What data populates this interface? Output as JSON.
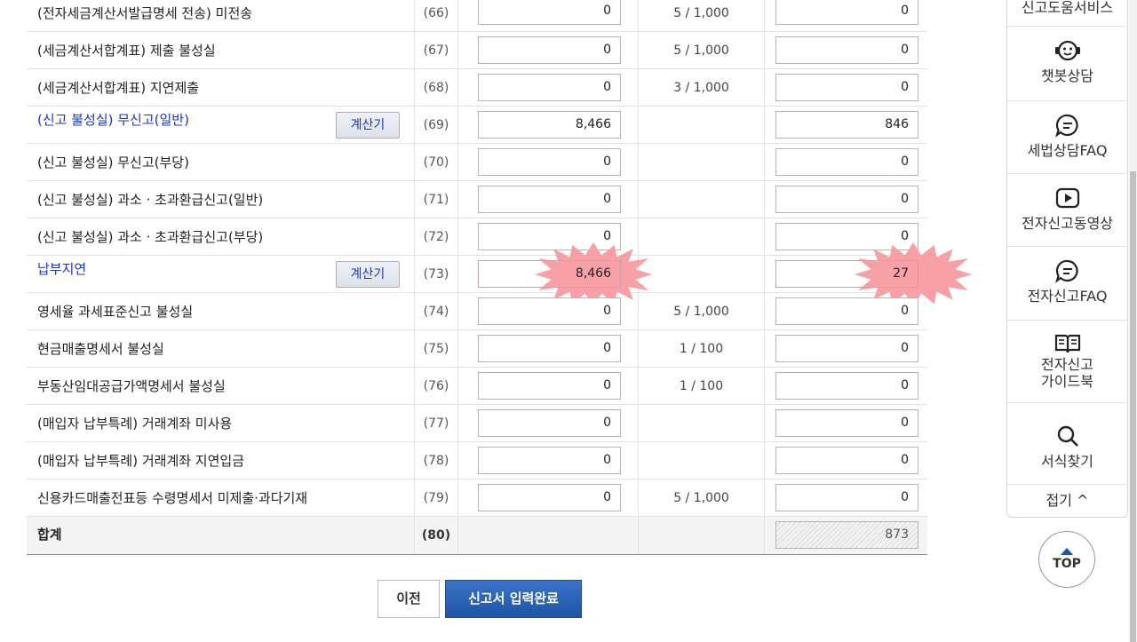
{
  "rows": [
    {
      "label": "(전자세금계산서발급명세 전송) 미전송",
      "code": "(66)",
      "amount": "0",
      "rate": "5 / 1,000",
      "penalty": "0"
    },
    {
      "label": "(세금계산서합계표) 제출 불성실",
      "code": "(67)",
      "amount": "0",
      "rate": "5 / 1,000",
      "penalty": "0"
    },
    {
      "label": "(세금계산서합계표) 지연제출",
      "code": "(68)",
      "amount": "0",
      "rate": "3 / 1,000",
      "penalty": "0"
    },
    {
      "label": "(신고 불성실) 무신고(일반)",
      "code": "(69)",
      "amount": "8,466",
      "rate": "",
      "penalty": "846",
      "calc": "계산기"
    },
    {
      "label": "(신고 불성실) 무신고(부당)",
      "code": "(70)",
      "amount": "0",
      "rate": "",
      "penalty": "0"
    },
    {
      "label": "(신고 불성실) 과소 · 초과환급신고(일반)",
      "code": "(71)",
      "amount": "0",
      "rate": "",
      "penalty": "0"
    },
    {
      "label": "(신고 불성실) 과소 · 초과환급신고(부당)",
      "code": "(72)",
      "amount": "0",
      "rate": "",
      "penalty": "0"
    },
    {
      "label": "납부지연",
      "code": "(73)",
      "amount": "8,466",
      "rate": "",
      "penalty": "27",
      "calc": "계산기"
    },
    {
      "label": "영세율 과세표준신고 불성실",
      "code": "(74)",
      "amount": "0",
      "rate": "5 / 1,000",
      "penalty": "0"
    },
    {
      "label": "현금매출명세서 불성실",
      "code": "(75)",
      "amount": "0",
      "rate": "1 / 100",
      "penalty": "0"
    },
    {
      "label": "부동산임대공급가액명세서 불성실",
      "code": "(76)",
      "amount": "0",
      "rate": "1 / 100",
      "penalty": "0"
    },
    {
      "label": "(매입자 납부특례) 거래계좌 미사용",
      "code": "(77)",
      "amount": "0",
      "rate": "",
      "penalty": "0"
    },
    {
      "label": "(매입자 납부특례) 거래계좌 지연입금",
      "code": "(78)",
      "amount": "0",
      "rate": "",
      "penalty": "0"
    },
    {
      "label": "신용카드매출전표등 수령명세서 미제출·과다기재",
      "code": "(79)",
      "amount": "0",
      "rate": "5 / 1,000",
      "penalty": "0"
    }
  ],
  "total": {
    "label": "합계",
    "code": "(80)",
    "penalty": "873"
  },
  "buttons": {
    "prev": "이전",
    "done": "신고서 입력완료"
  },
  "sidebar": {
    "top_partial": "신고도움서비스",
    "items": [
      {
        "label": "챗봇상담",
        "icon": "chatbot-icon"
      },
      {
        "label": "세법상담FAQ",
        "icon": "faq-chat-icon"
      },
      {
        "label": "전자신고동영상",
        "icon": "video-play-icon"
      },
      {
        "label": "전자신고FAQ",
        "icon": "faq-chat-icon"
      },
      {
        "label": "전자신고",
        "label2": "가이드북",
        "icon": "book-icon"
      },
      {
        "label": "서식찾기",
        "icon": "search-icon"
      }
    ],
    "collapse": "접기 ^",
    "top": "TOP"
  },
  "colors": {
    "highlight": "#f7a1a6",
    "link_blue": "#1a37c8",
    "primary_button": "#1f54a6"
  }
}
